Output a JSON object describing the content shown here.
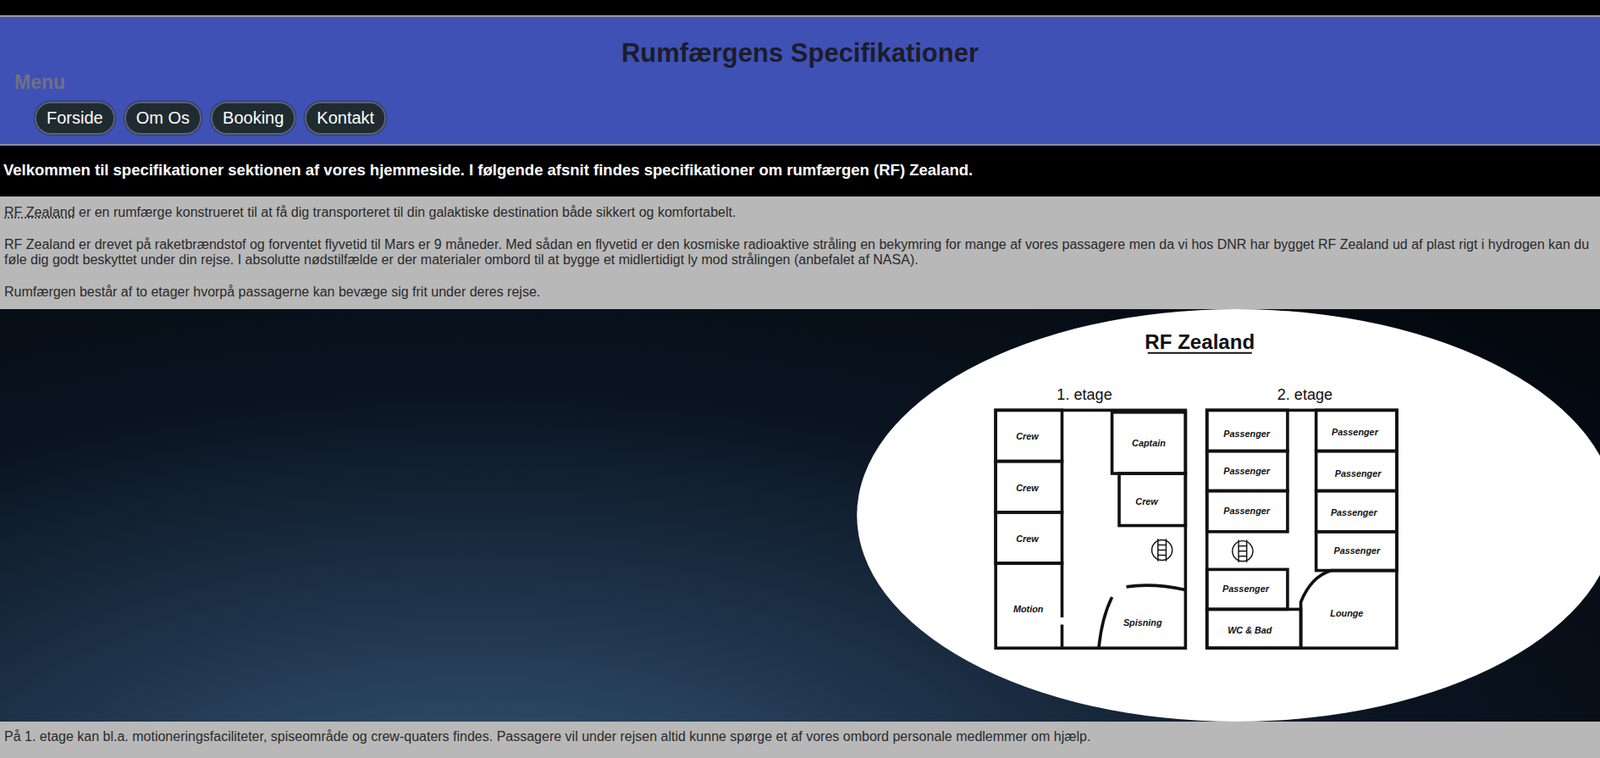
{
  "page": {
    "title": "Rumfærgens Specifikationer"
  },
  "menu": {
    "label": "Menu",
    "items": [
      "Forside",
      "Om Os",
      "Booking",
      "Kontakt"
    ]
  },
  "intro": "Velkommen til specifikationer sektionen af vores hjemmeside. I følgende afsnit findes specifikationer om rumfærgen (RF) Zealand.",
  "paragraphs": [
    {
      "lead": "RF Zealand",
      "text": "er en rumfærge konstrueret til at få dig transporteret til din galaktiske destination både sikkert og komfortabelt."
    },
    {
      "lead": "",
      "text": "RF Zealand er drevet på raketbrændstof og forventet flyvetid til Mars er 9 måneder. Med sådan en flyvetid er den kosmiske radioaktive stråling en bekymring for mange af vores passagere men da vi hos DNR har bygget RF Zealand ud af plast rigt i hydrogen kan du føle dig godt beskyttet under din rejse. I absolutte nødstilfælde er der materialer ombord til at bygge et midlertidigt ly mod strålingen (anbefalet af NASA)."
    },
    {
      "lead": "",
      "text": "Rumfærgen består af to etager hvorpå passagerne kan bevæge sig frit under deres rejse."
    }
  ],
  "floorplan": {
    "title": "RF Zealand",
    "floors": [
      {
        "label": "1. etage",
        "rooms": [
          "Crew",
          "Crew",
          "Crew",
          "Motion",
          "Captain",
          "Crew",
          "Spisning"
        ]
      },
      {
        "label": "2. etage",
        "rooms": [
          "Passenger",
          "Passenger",
          "Passenger",
          "Passenger",
          "WC & Bad",
          "Passenger",
          "Passenger",
          "Passenger",
          "Passenger",
          "Lounge"
        ]
      }
    ]
  },
  "footer_text": "På 1. etage kan bl.a. motioneringsfaciliteter, spiseområde og crew-quaters findes. Passagere vil under rejsen altid kunne spørge et af vores ombord personale medlemmer om hjælp."
}
